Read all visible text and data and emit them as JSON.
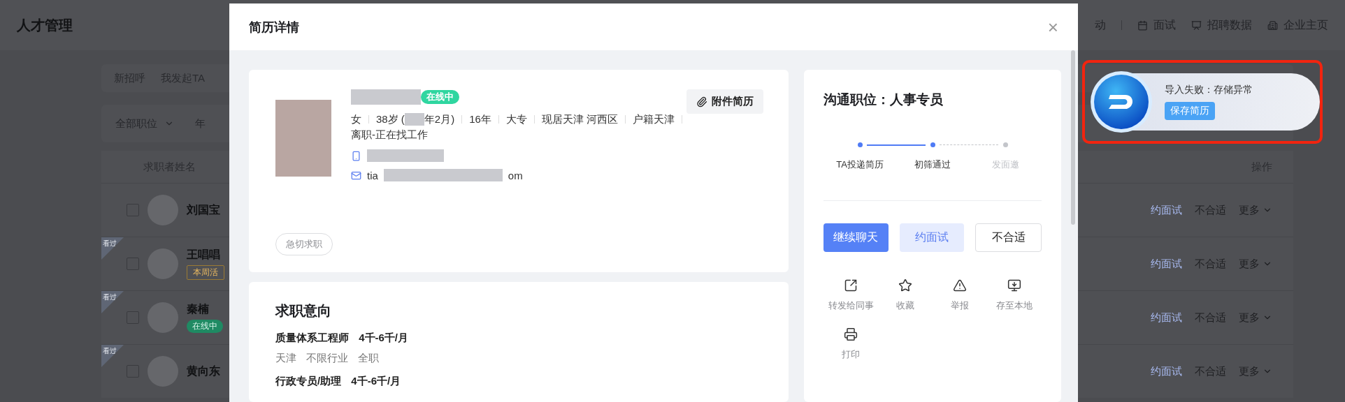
{
  "app": {
    "title": "人才管理",
    "nav": [
      {
        "label": "动",
        "kind": "none"
      },
      {
        "label": "面试",
        "kind": "calendar"
      },
      {
        "label": "招聘数据",
        "kind": "chart"
      },
      {
        "label": "企业主页",
        "kind": "building"
      }
    ],
    "tabs": [
      "新招呼",
      "我发起TA"
    ],
    "filters": [
      {
        "label": "全部职位",
        "dropdown": true
      },
      {
        "label": "年",
        "dropdown": false
      }
    ],
    "table": {
      "columns": [
        "求职者姓名",
        "操作"
      ],
      "rows": [
        {
          "name": "刘国宝",
          "checked": false,
          "ribbon": null,
          "badge": null,
          "actions": [
            "约面试",
            "不合适",
            "更多"
          ]
        },
        {
          "name": "王唱唱",
          "checked": false,
          "ribbon": "看过",
          "badge": {
            "text": "本周活",
            "kind": "active"
          },
          "actions": [
            "约面试",
            "不合适",
            "更多"
          ]
        },
        {
          "name": "秦楠",
          "checked": false,
          "ribbon": "看过",
          "badge": {
            "text": "在线中",
            "kind": "online"
          },
          "actions": [
            "约面试",
            "不合适",
            "更多"
          ]
        },
        {
          "name": "黄向东",
          "checked": false,
          "ribbon": "看过",
          "badge": null,
          "actions": [
            "约面试",
            "不合适",
            "更多"
          ]
        }
      ]
    }
  },
  "modal": {
    "title": "简历详情",
    "close": "×",
    "profile": {
      "status": "在线中",
      "attachment_button": "附件简历",
      "info": [
        {
          "text": "女",
          "redacted": false
        },
        {
          "text": "38岁 (",
          "redacted": true,
          "tail": "年2月)"
        },
        {
          "text": "16年",
          "redacted": false
        },
        {
          "text": "大专",
          "redacted": false
        },
        {
          "text": "现居天津 河西区",
          "redacted": false
        },
        {
          "text": "户籍天津",
          "redacted": false
        },
        {
          "text": "离职-正在找工作",
          "redacted": false
        }
      ],
      "contacts": [
        {
          "kind": "phone"
        },
        {
          "kind": "email",
          "prefix": "tia",
          "suffix": "om"
        }
      ],
      "tag": "急切求职"
    },
    "intent": {
      "title": "求职意向",
      "items": [
        {
          "position": "质量体系工程师",
          "salary": "4千-6千/月",
          "details": [
            "天津",
            "不限行业",
            "全职"
          ]
        },
        {
          "position": "行政专员/助理",
          "salary": "4千-6千/月"
        }
      ]
    },
    "side": {
      "title": "沟通职位：人事专员",
      "steps": [
        {
          "label": "TA投递简历",
          "done": true
        },
        {
          "label": "初筛通过",
          "done": true
        },
        {
          "label": "发面邀",
          "done": false
        }
      ],
      "buttons": [
        {
          "label": "继续聊天",
          "kind": "primary"
        },
        {
          "label": "约面试",
          "kind": "light"
        },
        {
          "label": "不合适",
          "kind": "outline"
        }
      ],
      "actions": [
        {
          "label": "转发给同事",
          "kind": "forward"
        },
        {
          "label": "收藏",
          "kind": "favorite"
        },
        {
          "label": "举报",
          "kind": "report"
        },
        {
          "label": "存至本地",
          "kind": "download"
        },
        {
          "label": "打印",
          "kind": "print"
        }
      ]
    }
  },
  "widget": {
    "message": "导入失败：存储异常",
    "button": "保存简历"
  }
}
